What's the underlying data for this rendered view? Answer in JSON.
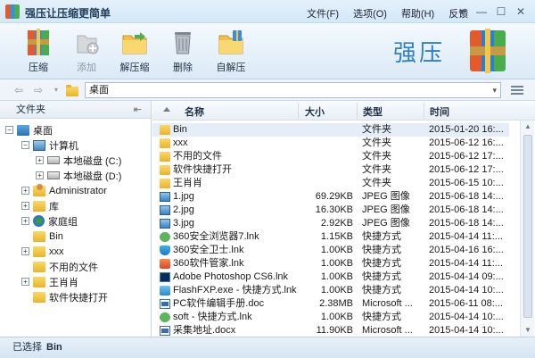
{
  "window": {
    "title": "强压让压缩更简单",
    "menu": [
      "文件(F)",
      "选项(O)",
      "帮助(H)",
      "反馈"
    ],
    "controls": [
      "▾",
      "—",
      "☐",
      "✕"
    ]
  },
  "toolbar": {
    "buttons": [
      {
        "label": "压缩",
        "icon": "compress-archive-icon",
        "enabled": true
      },
      {
        "label": "添加",
        "icon": "add-file-icon",
        "enabled": false
      },
      {
        "label": "解压缩",
        "icon": "extract-folder-icon",
        "enabled": true
      },
      {
        "label": "删除",
        "icon": "trash-icon",
        "enabled": true
      },
      {
        "label": "自解压",
        "icon": "self-extract-icon",
        "enabled": true
      }
    ],
    "brand_text": "强压"
  },
  "address": {
    "current": "桌面",
    "back": "⇦",
    "forward": "⇨",
    "dropdown": "▾"
  },
  "folder_pane": {
    "header": "文件夹",
    "pin": "⇤",
    "tree": [
      {
        "label": "桌面",
        "icon": "desktop",
        "expander": "−",
        "level": 0
      },
      {
        "label": "计算机",
        "icon": "computer",
        "expander": "−",
        "level": 1
      },
      {
        "label": "本地磁盘 (C:)",
        "icon": "drive",
        "expander": "+",
        "level": 2
      },
      {
        "label": "本地磁盘 (D:)",
        "icon": "drive",
        "expander": "+",
        "level": 2
      },
      {
        "label": "Administrator",
        "icon": "user",
        "expander": "+",
        "level": 1
      },
      {
        "label": "库",
        "icon": "folder",
        "expander": "+",
        "level": 1
      },
      {
        "label": "家庭组",
        "icon": "net",
        "expander": "+",
        "level": 1
      },
      {
        "label": "Bin",
        "icon": "folder",
        "expander": "",
        "level": 1
      },
      {
        "label": "xxx",
        "icon": "folder",
        "expander": "+",
        "level": 1
      },
      {
        "label": "不用的文件",
        "icon": "folder",
        "expander": "",
        "level": 1
      },
      {
        "label": "王肖肖",
        "icon": "folder",
        "expander": "+",
        "level": 1
      },
      {
        "label": "软件快捷打开",
        "icon": "folder",
        "expander": "",
        "level": 1
      }
    ]
  },
  "file_list": {
    "columns": {
      "name": "名称",
      "size": "大小",
      "type": "类型",
      "time": "时间"
    },
    "rows": [
      {
        "name": "Bin",
        "size": "",
        "type": "文件夹",
        "time": "2015-01-20 16:...",
        "icon": "folder",
        "selected": true
      },
      {
        "name": "xxx",
        "size": "",
        "type": "文件夹",
        "time": "2015-06-12 16:...",
        "icon": "folder"
      },
      {
        "name": "不用的文件",
        "size": "",
        "type": "文件夹",
        "time": "2015-06-12 17:...",
        "icon": "folder"
      },
      {
        "name": "软件快捷打开",
        "size": "",
        "type": "文件夹",
        "time": "2015-06-12 17:...",
        "icon": "folder"
      },
      {
        "name": "王肖肖",
        "size": "",
        "type": "文件夹",
        "time": "2015-06-15 10:...",
        "icon": "folder"
      },
      {
        "name": "1.jpg",
        "size": "69.29KB",
        "type": "JPEG 图像",
        "time": "2015-06-18 14:...",
        "icon": "jpeg"
      },
      {
        "name": "2.jpg",
        "size": "16.30KB",
        "type": "JPEG 图像",
        "time": "2015-06-18 14:...",
        "icon": "jpeg"
      },
      {
        "name": "3.jpg",
        "size": "2.92KB",
        "type": "JPEG 图像",
        "time": "2015-06-18 14:...",
        "icon": "jpeg"
      },
      {
        "name": "360安全浏览器7.lnk",
        "size": "1.15KB",
        "type": "快捷方式",
        "time": "2015-04-14 11:...",
        "icon": "lnk-green"
      },
      {
        "name": "360安全卫士.lnk",
        "size": "1.00KB",
        "type": "快捷方式",
        "time": "2015-04-16 16:...",
        "icon": "lnk-shield"
      },
      {
        "name": "360软件管家.lnk",
        "size": "1.00KB",
        "type": "快捷方式",
        "time": "2015-04-14 11:...",
        "icon": "lnk-red"
      },
      {
        "name": "Adobe Photoshop CS6.lnk",
        "size": "1.00KB",
        "type": "快捷方式",
        "time": "2015-04-14 09:...",
        "icon": "ps"
      },
      {
        "name": "FlashFXP.exe - 快捷方式.lnk",
        "size": "1.00KB",
        "type": "快捷方式",
        "time": "2015-04-14 10:...",
        "icon": "ffxp"
      },
      {
        "name": "PC软件编辑手册.doc",
        "size": "2.38MB",
        "type": "Microsoft ...",
        "time": "2015-06-11 08:...",
        "icon": "doc"
      },
      {
        "name": "soft - 快捷方式.lnk",
        "size": "1.00KB",
        "type": "快捷方式",
        "time": "2015-04-14 10:...",
        "icon": "lnk-green"
      },
      {
        "name": "采集地址.docx",
        "size": "11.90KB",
        "type": "Microsoft ...",
        "time": "2015-04-14 10:...",
        "icon": "doc"
      }
    ]
  },
  "status": {
    "label": "已选择",
    "value": "Bin"
  }
}
